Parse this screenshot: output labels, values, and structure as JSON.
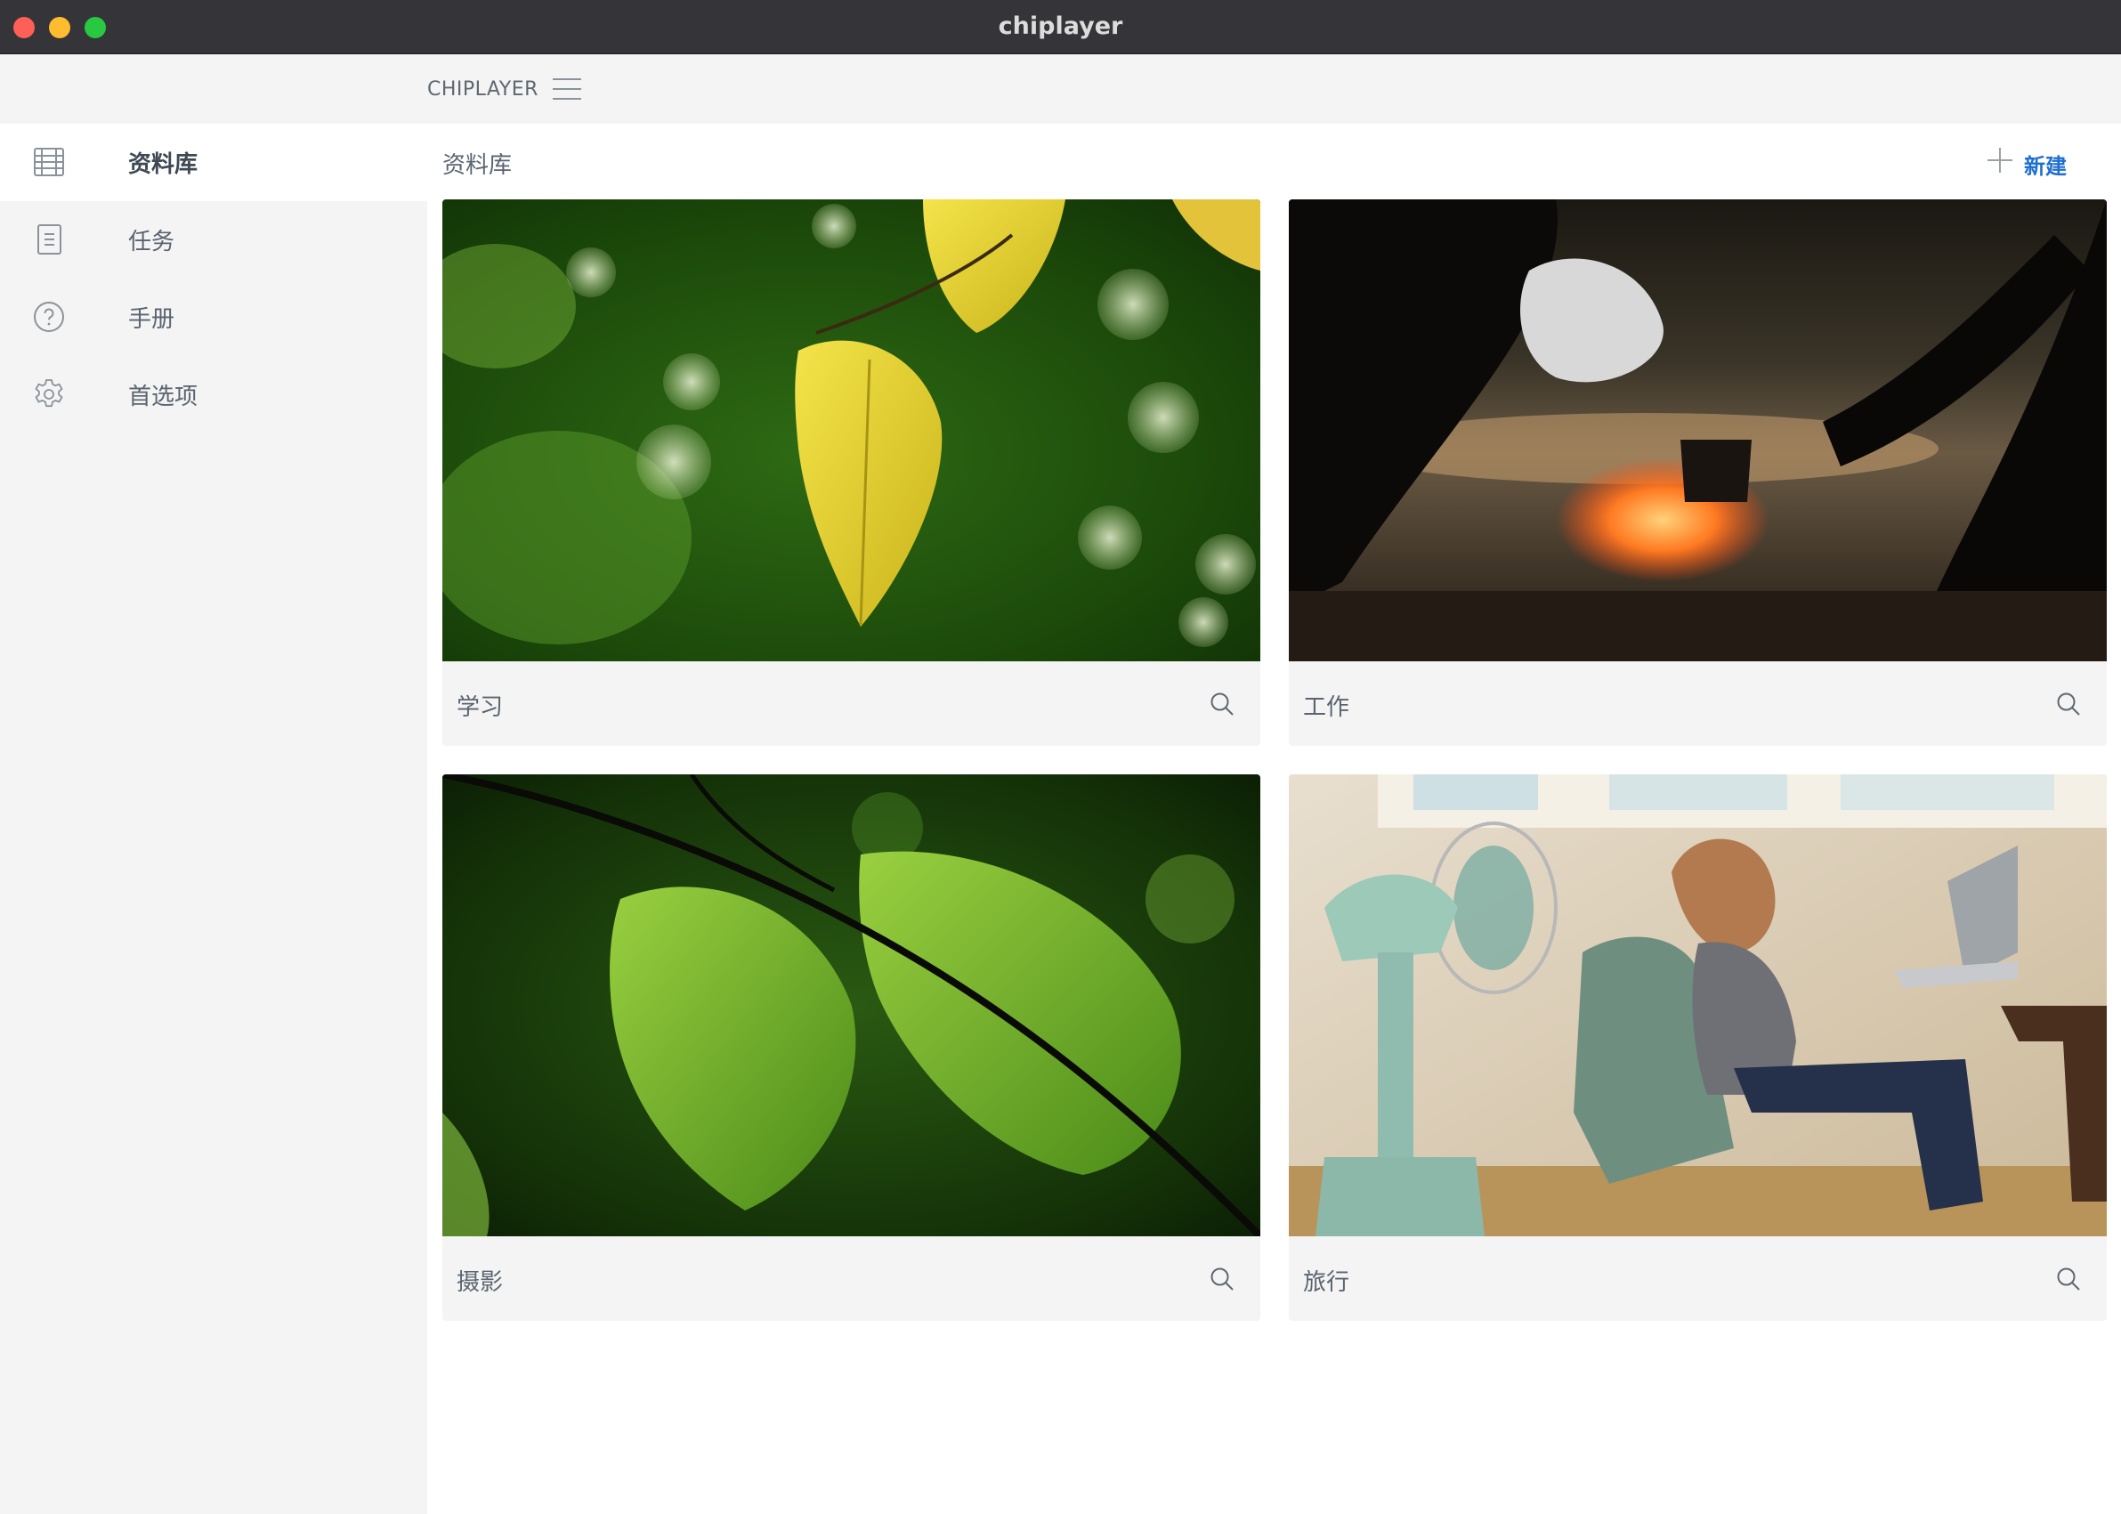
{
  "window": {
    "title": "chiplayer"
  },
  "header": {
    "brand": "CHIPLAYER",
    "menu_icon": "hamburger-menu-icon"
  },
  "sidebar": {
    "items": [
      {
        "label": "资料库",
        "icon": "library-grid-icon",
        "active": true
      },
      {
        "label": "任务",
        "icon": "document-icon",
        "active": false
      },
      {
        "label": "手册",
        "icon": "help-circle-icon",
        "active": false
      },
      {
        "label": "首选项",
        "icon": "gear-icon",
        "active": false
      }
    ]
  },
  "main": {
    "title": "资料库",
    "new_label": "新建",
    "new_icon": "plus-icon",
    "cards": [
      {
        "label": "学习",
        "image": "yellow-leaves-bokeh-photo"
      },
      {
        "label": "工作",
        "image": "campfire-kettle-photo"
      },
      {
        "label": "摄影",
        "image": "green-leaves-branch-photo"
      },
      {
        "label": "旅行",
        "image": "woman-laptop-fan-photo"
      }
    ]
  },
  "colors": {
    "titlebar": "#353439",
    "sidebar_bg": "#f4f4f4",
    "accent": "#1f6fd0",
    "text": "#5a6470"
  }
}
